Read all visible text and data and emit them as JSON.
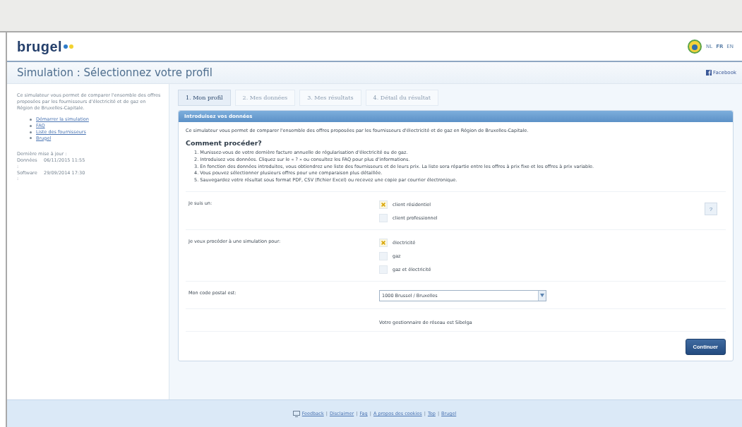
{
  "header": {
    "logo": "brugel",
    "languages": [
      {
        "label": "NL",
        "selected": false
      },
      {
        "label": "FR",
        "selected": true
      },
      {
        "label": "EN",
        "selected": false
      }
    ]
  },
  "title_bar": {
    "title": "Simulation : Sélectionnez votre profil",
    "facebook": "Facebook"
  },
  "sidebar": {
    "intro": "Ce simulateur vous permet de comparer l'ensemble des offres proposées par les fournisseurs d'électricité et de gaz en Région de Bruxelles-Capitale.",
    "links": [
      "Démarrer la simulation",
      "FAQ",
      "Liste des fournisseurs",
      "Brugel"
    ],
    "update_title": "Dernière mise à jour :",
    "updates": [
      {
        "label": "Données :",
        "value": "06/11/2015 11:55"
      },
      {
        "label": "Software :",
        "value": "29/09/2014 17:30"
      }
    ]
  },
  "tabs": [
    {
      "label": "1. Mon profil",
      "selected": true
    },
    {
      "label": "2. Mes données",
      "selected": false
    },
    {
      "label": "3. Mes résultats",
      "selected": false
    },
    {
      "label": "4. Détail du résultat",
      "selected": false
    }
  ],
  "panel": {
    "header": "Introduisez vos données",
    "intro": "Ce simulateur vous permet de comparer l'ensemble des offres proposées par les fournisseurs d'électricité et de gaz en Région de Bruxelles-Capitale.",
    "how_title": "Comment procéder?",
    "steps": [
      "1. Munissez-vous de votre dernière facture annuelle de régularisation d'électricité ou de gaz.",
      "2. Introduisez vos données. Cliquez sur le « ? » ou consultez les FAQ pour plus d'informations.",
      "3. En fonction des données introduites, vous obtiendrez une liste des fournisseurs et de leurs prix. La liste sera répartie entre les offres à prix fixe et les offres à prix variable.",
      "4. Vous pouvez sélectionner plusieurs offres pour une comparaison plus détaillée.",
      "5. Sauvegardez votre résultat sous format PDF, CSV (fichier Excel) ou recevez une copie par courrier électronique."
    ],
    "questions": [
      {
        "kind": "radio",
        "label": "Je suis un:",
        "help": "?",
        "options": [
          {
            "label": "client résidentiel",
            "selected": true
          },
          {
            "label": "client professionnel",
            "selected": false
          }
        ]
      },
      {
        "kind": "radio",
        "label": "Je veux procéder à une simulation pour:",
        "options": [
          {
            "label": "électricité",
            "selected": true
          },
          {
            "label": "gaz",
            "selected": false
          },
          {
            "label": "gaz et électricité",
            "selected": false
          }
        ]
      },
      {
        "kind": "select",
        "label": "Mon code postal est:",
        "value": "1000 Brussel / Bruxelles",
        "note": "Votre gestionnaire de réseau est Sibelga"
      }
    ],
    "continue": "Continuer"
  },
  "footer": {
    "links": [
      "Feedback",
      "Disclaimer",
      "Faq",
      "A propos des cookies",
      "Top",
      "Brugel"
    ],
    "separators": [
      "|",
      "|",
      "|",
      "|",
      "|"
    ]
  }
}
